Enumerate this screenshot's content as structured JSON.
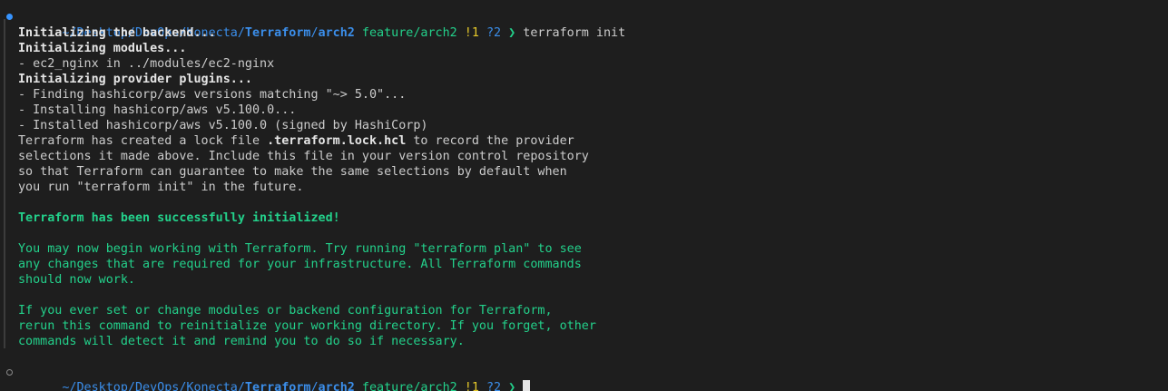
{
  "prompt1": {
    "path_prefix": "~/Desktop/DevOps/Konecta/",
    "path_bold1": "Terraform",
    "path_sep": "/",
    "path_bold2": "arch2",
    "branch": "feature/arch2",
    "modified": "!1",
    "untracked": "?2",
    "arrow": "❯",
    "command": "terraform init"
  },
  "output": {
    "l1": "Initializing the backend...",
    "l2": "Initializing modules...",
    "l3": "- ec2_nginx in ../modules/ec2-nginx",
    "l4": "Initializing provider plugins...",
    "l5": "- Finding hashicorp/aws versions matching \"~> 5.0\"...",
    "l6": "- Installing hashicorp/aws v5.100.0...",
    "l7": "- Installed hashicorp/aws v5.100.0 (signed by HashiCorp)",
    "l8a": "Terraform has created a lock file ",
    "l8b": ".terraform.lock.hcl",
    "l8c": " to record the provider",
    "l9": "selections it made above. Include this file in your version control repository",
    "l10": "so that Terraform can guarantee to make the same selections by default when",
    "l11": "you run \"terraform init\" in the future.",
    "success": "Terraform has been successfully initialized!",
    "p1": "You may now begin working with Terraform. Try running \"terraform plan\" to see",
    "p2": "any changes that are required for your infrastructure. All Terraform commands",
    "p3": "should now work.",
    "p4": "If you ever set or change modules or backend configuration for Terraform,",
    "p5": "rerun this command to reinitialize your working directory. If you forget, other",
    "p6": "commands will detect it and remind you to do so if necessary."
  },
  "prompt2": {
    "path_prefix": "~/Desktop/DevOps/Konecta/",
    "path_bold1": "Terraform",
    "path_sep": "/",
    "path_bold2": "arch2",
    "branch": "feature/arch2",
    "modified": "!1",
    "untracked": "?2",
    "arrow": "❯"
  },
  "colors": {
    "background": "#1e1e1e",
    "path": "#3b8eea",
    "branch": "#23d18b",
    "modified": "#e5c82a",
    "success": "#23d18b"
  }
}
